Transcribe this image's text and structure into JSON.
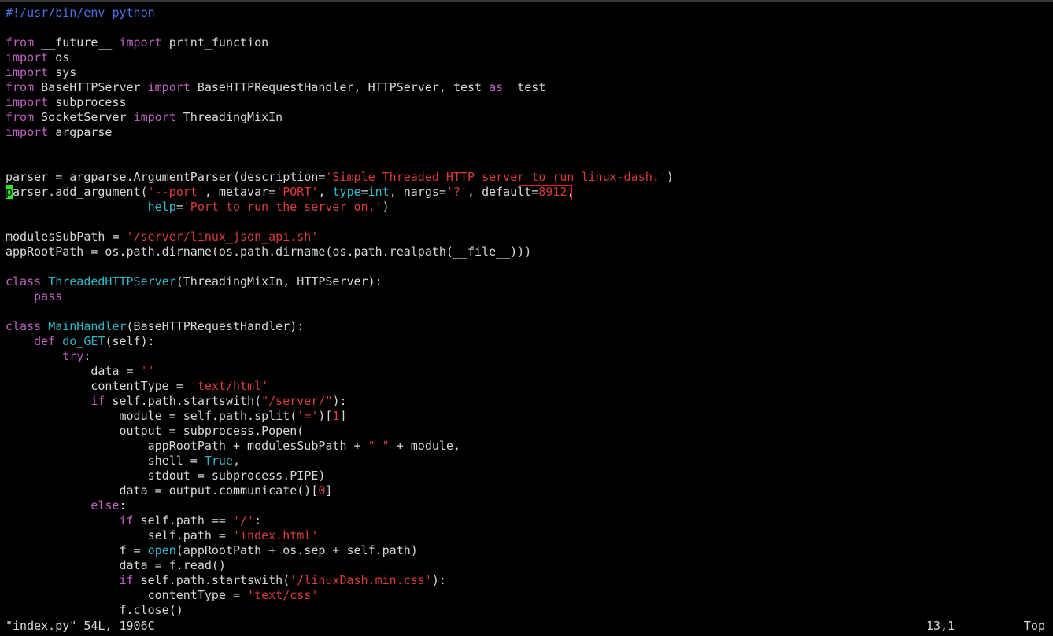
{
  "editor": {
    "lines": [
      [
        {
          "t": "#!/usr/bin/env python",
          "c": "comment"
        }
      ],
      [],
      [
        {
          "t": "from",
          "c": "keyword"
        },
        {
          "t": " __future__ ",
          "c": "default"
        },
        {
          "t": "import",
          "c": "keyword"
        },
        {
          "t": " print_function",
          "c": "default"
        }
      ],
      [
        {
          "t": "import",
          "c": "keyword"
        },
        {
          "t": " os",
          "c": "default"
        }
      ],
      [
        {
          "t": "import",
          "c": "keyword"
        },
        {
          "t": " sys",
          "c": "default"
        }
      ],
      [
        {
          "t": "from",
          "c": "keyword"
        },
        {
          "t": " BaseHTTPServer ",
          "c": "default"
        },
        {
          "t": "import",
          "c": "keyword"
        },
        {
          "t": " BaseHTTPRequestHandler, HTTPServer, test ",
          "c": "default"
        },
        {
          "t": "as",
          "c": "keyword"
        },
        {
          "t": " _test",
          "c": "default"
        }
      ],
      [
        {
          "t": "import",
          "c": "keyword"
        },
        {
          "t": " subprocess",
          "c": "default"
        }
      ],
      [
        {
          "t": "from",
          "c": "keyword"
        },
        {
          "t": " SocketServer ",
          "c": "default"
        },
        {
          "t": "import",
          "c": "keyword"
        },
        {
          "t": " ThreadingMixIn",
          "c": "default"
        }
      ],
      [
        {
          "t": "import",
          "c": "keyword"
        },
        {
          "t": " argparse",
          "c": "default"
        }
      ],
      [],
      [],
      [
        {
          "t": "parser = argparse.ArgumentParser(description=",
          "c": "default"
        },
        {
          "t": "'Simple Threaded HTTP server to run linux-dash.'",
          "c": "string"
        },
        {
          "t": ")",
          "c": "default"
        }
      ],
      [
        {
          "t": "p",
          "c": "cursor"
        },
        {
          "t": "arser.add_argument(",
          "c": "default"
        },
        {
          "t": "'--port'",
          "c": "string"
        },
        {
          "t": ", metavar=",
          "c": "default"
        },
        {
          "t": "'PORT'",
          "c": "string"
        },
        {
          "t": ", ",
          "c": "default"
        },
        {
          "t": "type",
          "c": "builtin"
        },
        {
          "t": "=",
          "c": "default"
        },
        {
          "t": "int",
          "c": "builtin"
        },
        {
          "t": ", nargs=",
          "c": "default"
        },
        {
          "t": "'?'",
          "c": "string"
        },
        {
          "t": ", default=",
          "c": "default"
        },
        {
          "t": "8912",
          "c": "string"
        },
        {
          "t": ",",
          "c": "default"
        }
      ],
      [
        {
          "t": "                    ",
          "c": "default"
        },
        {
          "t": "help",
          "c": "builtin"
        },
        {
          "t": "=",
          "c": "default"
        },
        {
          "t": "'Port to run the server on.'",
          "c": "string"
        },
        {
          "t": ")",
          "c": "default"
        }
      ],
      [],
      [
        {
          "t": "modulesSubPath = ",
          "c": "default"
        },
        {
          "t": "'/server/linux_json_api.sh'",
          "c": "string"
        }
      ],
      [
        {
          "t": "appRootPath = os.path.dirname(os.path.dirname(os.path.realpath(__file__)))",
          "c": "default"
        }
      ],
      [],
      [
        {
          "t": "class",
          "c": "keyword"
        },
        {
          "t": " ",
          "c": "default"
        },
        {
          "t": "ThreadedHTTPServer",
          "c": "def"
        },
        {
          "t": "(ThreadingMixIn, HTTPServer):",
          "c": "default"
        }
      ],
      [
        {
          "t": "    ",
          "c": "default"
        },
        {
          "t": "pass",
          "c": "keyword"
        }
      ],
      [],
      [
        {
          "t": "class",
          "c": "keyword"
        },
        {
          "t": " ",
          "c": "default"
        },
        {
          "t": "MainHandler",
          "c": "def"
        },
        {
          "t": "(BaseHTTPRequestHandler):",
          "c": "default"
        }
      ],
      [
        {
          "t": "    ",
          "c": "default"
        },
        {
          "t": "def",
          "c": "keyword"
        },
        {
          "t": " ",
          "c": "default"
        },
        {
          "t": "do_GET",
          "c": "def"
        },
        {
          "t": "(self):",
          "c": "default"
        }
      ],
      [
        {
          "t": "        ",
          "c": "default"
        },
        {
          "t": "try",
          "c": "keyword"
        },
        {
          "t": ":",
          "c": "default"
        }
      ],
      [
        {
          "t": "            data = ",
          "c": "default"
        },
        {
          "t": "''",
          "c": "string"
        }
      ],
      [
        {
          "t": "            contentType = ",
          "c": "default"
        },
        {
          "t": "'text/html'",
          "c": "string"
        }
      ],
      [
        {
          "t": "            ",
          "c": "default"
        },
        {
          "t": "if",
          "c": "keyword"
        },
        {
          "t": " self.path.startswith(",
          "c": "default"
        },
        {
          "t": "\"/server/\"",
          "c": "string"
        },
        {
          "t": "):",
          "c": "default"
        }
      ],
      [
        {
          "t": "                module = self.path.split(",
          "c": "default"
        },
        {
          "t": "'='",
          "c": "string"
        },
        {
          "t": ")[",
          "c": "default"
        },
        {
          "t": "1",
          "c": "string"
        },
        {
          "t": "]",
          "c": "default"
        }
      ],
      [
        {
          "t": "                output = subprocess.Popen(",
          "c": "default"
        }
      ],
      [
        {
          "t": "                    appRootPath + modulesSubPath + ",
          "c": "default"
        },
        {
          "t": "\" \"",
          "c": "string"
        },
        {
          "t": " + module,",
          "c": "default"
        }
      ],
      [
        {
          "t": "                    shell = ",
          "c": "default"
        },
        {
          "t": "True",
          "c": "builtin"
        },
        {
          "t": ",",
          "c": "default"
        }
      ],
      [
        {
          "t": "                    stdout = subprocess.PIPE)",
          "c": "default"
        }
      ],
      [
        {
          "t": "                data = output.communicate()[",
          "c": "default"
        },
        {
          "t": "0",
          "c": "string"
        },
        {
          "t": "]",
          "c": "default"
        }
      ],
      [
        {
          "t": "            ",
          "c": "default"
        },
        {
          "t": "else",
          "c": "keyword"
        },
        {
          "t": ":",
          "c": "default"
        }
      ],
      [
        {
          "t": "                ",
          "c": "default"
        },
        {
          "t": "if",
          "c": "keyword"
        },
        {
          "t": " self.path == ",
          "c": "default"
        },
        {
          "t": "'/'",
          "c": "string"
        },
        {
          "t": ":",
          "c": "default"
        }
      ],
      [
        {
          "t": "                    self.path = ",
          "c": "default"
        },
        {
          "t": "'index.html'",
          "c": "string"
        }
      ],
      [
        {
          "t": "                f = ",
          "c": "default"
        },
        {
          "t": "open",
          "c": "builtin"
        },
        {
          "t": "(appRootPath + os.sep + self.path)",
          "c": "default"
        }
      ],
      [
        {
          "t": "                data = f.read()",
          "c": "default"
        }
      ],
      [
        {
          "t": "                ",
          "c": "default"
        },
        {
          "t": "if",
          "c": "keyword"
        },
        {
          "t": " self.path.startswith(",
          "c": "default"
        },
        {
          "t": "'/linuxDash.min.css'",
          "c": "string"
        },
        {
          "t": "):",
          "c": "default"
        }
      ],
      [
        {
          "t": "                    contentType = ",
          "c": "default"
        },
        {
          "t": "'text/css'",
          "c": "string"
        }
      ],
      [
        {
          "t": "                f.close()",
          "c": "default"
        }
      ]
    ]
  },
  "statusline": {
    "file": "\"index.py\" 54L, 1906C",
    "position": "13,1",
    "scroll": "Top"
  },
  "colors": {
    "background": "#000000",
    "default": "#d8d8d8",
    "keyword": "#c060c0",
    "string": "#d83c3c",
    "builtin": "#2eb6c8",
    "comment": "#4a74e6",
    "cursor": "#22ee22",
    "annotation_box": "#e02020"
  }
}
